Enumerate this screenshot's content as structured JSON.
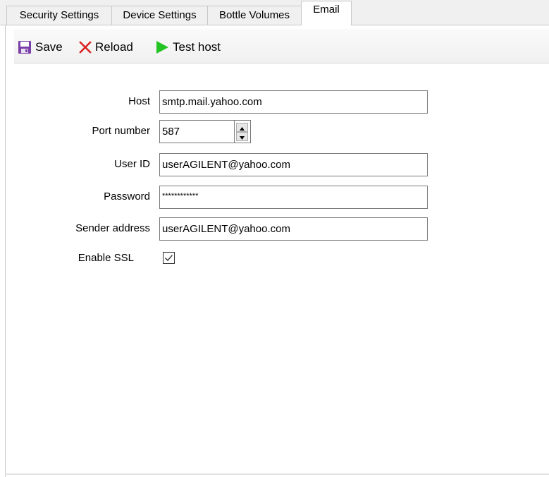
{
  "tabs": [
    {
      "label": "Security Settings",
      "active": false
    },
    {
      "label": "Device Settings",
      "active": false
    },
    {
      "label": "Bottle Volumes",
      "active": false
    },
    {
      "label": "Email",
      "active": true
    }
  ],
  "toolbar": {
    "save_label": "Save",
    "reload_label": "Reload",
    "test_host_label": "Test host",
    "icons": {
      "save": "floppy-disk-icon",
      "reload": "red-x-icon",
      "test_host": "green-play-icon"
    },
    "colors": {
      "save": "#7b3fa8",
      "reload": "#d92020",
      "test_host": "#22c322"
    }
  },
  "form": {
    "host": {
      "label": "Host",
      "value": "smtp.mail.yahoo.com"
    },
    "port": {
      "label": "Port number",
      "value": "587"
    },
    "user_id": {
      "label": "User ID",
      "value": "userAGILENT@yahoo.com"
    },
    "password": {
      "label": "Password",
      "value": "************"
    },
    "sender": {
      "label": "Sender address",
      "value": "userAGILENT@yahoo.com"
    },
    "ssl": {
      "label": "Enable SSL",
      "checked": true
    }
  }
}
